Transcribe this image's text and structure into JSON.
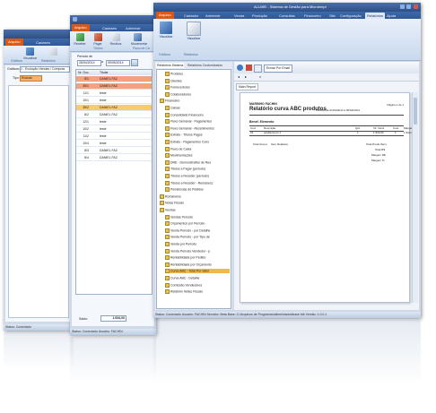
{
  "win1": {
    "tabs": [
      "Arquivo",
      "Cadastro"
    ],
    "ribbon_buttons": [
      "Visualizar"
    ],
    "ribbon_groups": [
      "Gráficos",
      "Relatórios"
    ],
    "grafico_label": "Gráficos:",
    "grafico_value": "1 - Evolução Vendas / Compras",
    "tipo_label": "Tipo:",
    "tipo_value": "Roscas",
    "status": "Status: Conectado"
  },
  "win2": {
    "tabs": [
      "Arquivo",
      "Cadastro",
      "Administr"
    ],
    "ribbon_buttons": [
      "Receber",
      "Pagar",
      "Recibos",
      "Movimentar"
    ],
    "ribbon_groups": [
      "Títulos",
      "Fluxo de Ca"
    ],
    "periodo_label": "Período de",
    "date_from": "28/04/2014",
    "date_to": "05/05/2014",
    "columns": [
      "Nr. Doc.",
      "Titular"
    ],
    "rows": [
      {
        "doc": "8/1",
        "name": "DANIEL FAZ"
      },
      {
        "doc": "35/1",
        "name": "DANIEL FAZ"
      },
      {
        "doc": "11/1",
        "name": "teste"
      },
      {
        "doc": "10/1",
        "name": "teste"
      },
      {
        "doc": "35/2",
        "name": "DANIEL FAZ"
      },
      {
        "doc": "8/2",
        "name": "DANIEL FAZ"
      },
      {
        "doc": "12/1",
        "name": "teste"
      },
      {
        "doc": "10/2",
        "name": "teste"
      },
      {
        "doc": "11/2",
        "name": "teste"
      },
      {
        "doc": "10/4",
        "name": "teste"
      },
      {
        "doc": "8/3",
        "name": "DANIEL FAZ"
      },
      {
        "doc": "8/4",
        "name": "DANIEL FAZ"
      }
    ],
    "saldo_label": "Saldo:",
    "saldo_value": "1.934,00",
    "status": "Status: Conectado  Usuário: FACHIN"
  },
  "win3": {
    "app_title": "ALLMEI - Sistema de Gestão para Microempr",
    "tabs": [
      "Arquivo",
      "Cadastro",
      "Administr",
      "Venda",
      "Produção",
      "Consultas",
      "Financeiro",
      "Site",
      "Configuração",
      "Relatórios",
      "Ajuda"
    ],
    "ribbon_buttons": [
      "Visualizar",
      "Visualizar"
    ],
    "ribbon_groups": [
      "Gráficos",
      "Relatórios"
    ],
    "panel_tabs": [
      "Relatórios Sistema",
      "Relatórios Customizados"
    ],
    "tree": [
      {
        "label": "Produtos",
        "level": 1
      },
      {
        "label": "Clientes",
        "level": 1
      },
      {
        "label": "Fornecedores",
        "level": 1
      },
      {
        "label": "Colaboradores",
        "level": 1
      },
      {
        "label": "Financeiro",
        "level": 0
      },
      {
        "label": "Caixas",
        "level": 1
      },
      {
        "label": "Consolidado Financeiro",
        "level": 1
      },
      {
        "label": "Fluxo Semanal - Pagamentos",
        "level": 1
      },
      {
        "label": "Fluxo Semanal - Recebimentos",
        "level": 1
      },
      {
        "label": "Extrato - Títulos Pagos",
        "level": 1
      },
      {
        "label": "Extrato - Pagamentos Cons",
        "level": 1
      },
      {
        "label": "Fluxo de Caixa",
        "level": 1
      },
      {
        "label": "Movimentações",
        "level": 1
      },
      {
        "label": "DRE - Demonstrativo de Res",
        "level": 1
      },
      {
        "label": "Títulos a Pagar (período)",
        "level": 1
      },
      {
        "label": "Títulos a Receber (período)",
        "level": 1
      },
      {
        "label": "Títulos a Receber - Remanesc",
        "level": 1
      },
      {
        "label": "Pendências de Pedidos",
        "level": 1
      },
      {
        "label": "Romaneios",
        "level": 0
      },
      {
        "label": "Notas Fiscais",
        "level": 0
      },
      {
        "label": "Vendas",
        "level": 0
      },
      {
        "label": "Vendas Período",
        "level": 1
      },
      {
        "label": "Orçamentos por Período",
        "level": 1
      },
      {
        "label": "Venda Período - por Detalhe",
        "level": 1
      },
      {
        "label": "Venda Período - por Tipo de",
        "level": 1
      },
      {
        "label": "Venda por Período",
        "level": 1
      },
      {
        "label": "Venda Período Vendedor - p",
        "level": 1
      },
      {
        "label": "Rentabilidade por Pedido",
        "level": 1
      },
      {
        "label": "Rentabilidade por Orçamento",
        "level": 1
      },
      {
        "label": "Curva ABC - Total Por Valor",
        "level": 1
      },
      {
        "label": "Curva ABC - Detalhe",
        "level": 1
      },
      {
        "label": "Comissão Vendedores",
        "level": 1
      },
      {
        "label": "Relatório Notas Fiscais",
        "level": 1
      }
    ],
    "selected_tree_index": 29,
    "toolbar_button": "Enviar Por Email",
    "main_report_tab": "Main Report",
    "report": {
      "company": "MARINHO FACHIN",
      "title": "Relatório curva ABC produtos",
      "period": "Período de 01/04/2014 a 30/04/2014",
      "page": "Página 1 de 1",
      "section": "Benef. Elemento",
      "columns": [
        "Cód.",
        "Descrição",
        "Qtd.",
        "Vlr. Vend.",
        "Cust.",
        "Margem"
      ],
      "row": [
        "01",
        "acabamento 1",
        "1",
        "1.934,00",
        "1",
        "1.934,00"
      ],
      "group_label": "Total Grupo:",
      "group_value": "Sem Relatório",
      "totals": [
        "Total Prods./Serv.",
        "Total R$",
        "Margem R$",
        "Margem %"
      ]
    },
    "status": "Status: Conectado  Usuário: FACHIN  Servidor: Beta  Base: C:\\Arquivos de Programas\\allmei\\dados\\base.fdb  Versão: 1.0.0.1"
  },
  "colors": {
    "accent_orange": "#d85a1a",
    "ribbon_blue": "#2f5797",
    "row_salmon": "#f4a27e",
    "row_yellow": "#f6cd6a",
    "selection": "#f0b84a"
  }
}
